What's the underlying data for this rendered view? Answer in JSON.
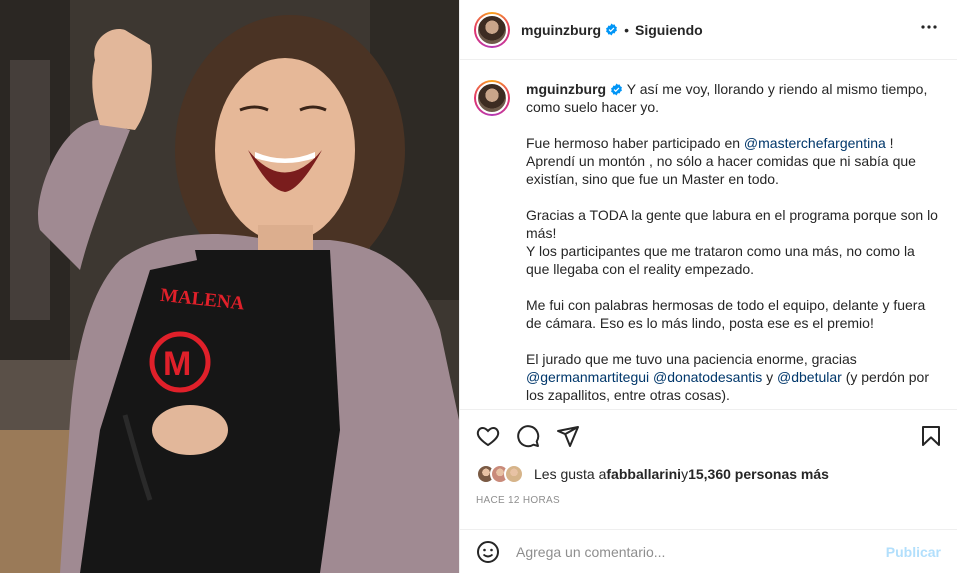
{
  "photo": {
    "apron_name": "MALENA",
    "logo_letter": "M"
  },
  "header": {
    "username": "mguinzburg",
    "separator": "•",
    "follow_status": "Siguiendo",
    "more_icon": "more-horizontal-icon"
  },
  "caption": {
    "username": "mguinzburg",
    "paragraphs": [
      {
        "parts": [
          {
            "t": "Y así me voy, llorando y riendo al mismo tiempo, como suelo hacer yo."
          }
        ]
      },
      {
        "parts": [
          {
            "t": "Fue hermoso haber participado en "
          },
          {
            "m": "@masterchefargentina"
          },
          {
            "t": " ! Aprendí un montón , no sólo a hacer comidas que ni sabía que existían, sino que fue un Master en todo."
          }
        ]
      },
      {
        "parts": [
          {
            "t": "Gracias a TODA la gente que labura en el programa porque son lo más!\nY los participantes que me trataron como una más, no como la que llegaba con el reality empezado."
          }
        ]
      },
      {
        "parts": [
          {
            "t": "Me fui con palabras hermosas de todo el equipo, delante y fuera de cámara. Eso es lo más lindo, posta ese es el premio!"
          }
        ]
      },
      {
        "parts": [
          {
            "t": "El jurado que me tuvo una paciencia enorme, gracias "
          },
          {
            "m": "@germanmartitegui"
          },
          {
            "t": " "
          },
          {
            "m": "@donatodesantis"
          },
          {
            "t": " y "
          },
          {
            "m": "@dbetular"
          },
          {
            "t": " (y perdón por los zapallitos, entre otras cosas)."
          }
        ]
      }
    ]
  },
  "actions": {
    "icons": [
      "heart-icon",
      "comment-icon",
      "share-icon",
      "bookmark-icon"
    ]
  },
  "likes": {
    "prefix": "Les gusta a ",
    "user": "fabballarini",
    "middle": " y ",
    "count_text": "15,360 personas más",
    "face_colors": [
      "#7a5a44",
      "#c98a7a",
      "#d6b48a"
    ]
  },
  "time_ago": "HACE 12 HORAS",
  "comment": {
    "placeholder": "Agrega un comentario...",
    "publish_label": "Publicar"
  },
  "colors": {
    "accent": "#0095f6",
    "publish_disabled": "#b2dffc",
    "mention": "#00376b",
    "apron_red": "#e0202a"
  }
}
